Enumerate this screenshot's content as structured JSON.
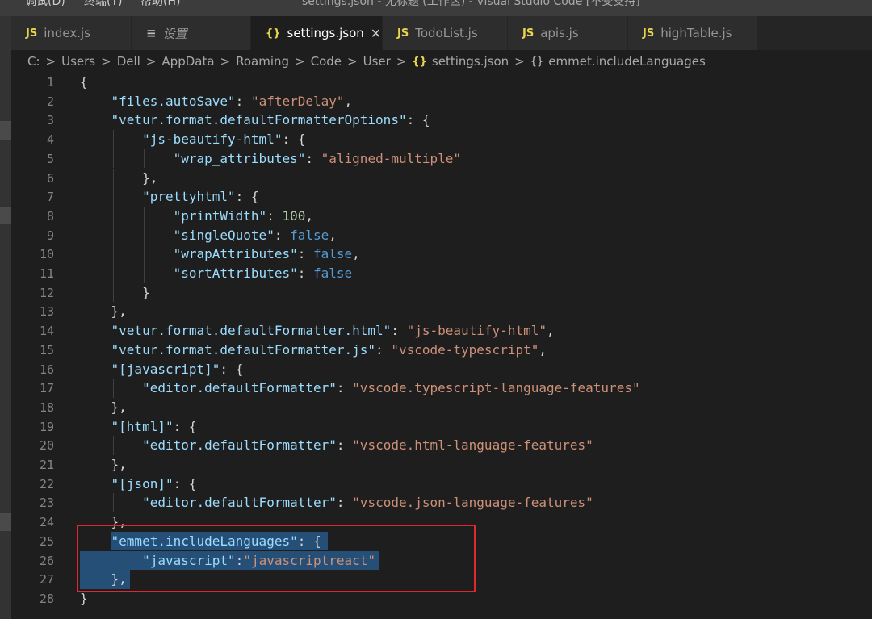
{
  "menubar": {
    "items": [
      "调试(D)",
      "终端(T)",
      "帮助(H)"
    ],
    "window_title": "settings.json - 无标题 (工作区) - Visual Studio Code [不受支持]"
  },
  "tabs": [
    {
      "icon": "JS",
      "label": "index.js",
      "active": false
    },
    {
      "icon": "≡",
      "label": "设置",
      "active": false
    },
    {
      "icon": "{}",
      "label": "settings.json",
      "active": true,
      "close": "✕"
    },
    {
      "icon": "JS",
      "label": "TodoList.js",
      "active": false
    },
    {
      "icon": "JS",
      "label": "apis.js",
      "active": false
    },
    {
      "icon": "JS",
      "label": "highTable.js",
      "active": false
    }
  ],
  "breadcrumb": {
    "segments": [
      "C:",
      "Users",
      "Dell",
      "AppData",
      "Roaming",
      "Code",
      "User"
    ],
    "file": "settings.json",
    "symbol": "emmet.includeLanguages",
    "separator": ">",
    "file_icon": "{}",
    "symbol_icon": "{}"
  },
  "editor": {
    "line_numbers": [
      "1",
      "2",
      "3",
      "4",
      "5",
      "6",
      "7",
      "8",
      "9",
      "10",
      "11",
      "12",
      "13",
      "14",
      "15",
      "16",
      "17",
      "18",
      "19",
      "20",
      "21",
      "22",
      "23",
      "24",
      "25",
      "26",
      "27",
      "28"
    ],
    "lines": [
      "{",
      "    \"files.autoSave\": \"afterDelay\",",
      "    \"vetur.format.defaultFormatterOptions\": {",
      "        \"js-beautify-html\": {",
      "            \"wrap_attributes\": \"aligned-multiple\"",
      "        },",
      "        \"prettyhtml\": {",
      "            \"printWidth\": 100,",
      "            \"singleQuote\": false,",
      "            \"wrapAttributes\": false,",
      "            \"sortAttributes\": false",
      "        }",
      "    },",
      "    \"vetur.format.defaultFormatter.html\": \"js-beautify-html\",",
      "    \"vetur.format.defaultFormatter.js\": \"vscode-typescript\",",
      "    \"[javascript]\": {",
      "        \"editor.defaultFormatter\": \"vscode.typescript-language-features\"",
      "    },",
      "    \"[html]\": {",
      "        \"editor.defaultFormatter\": \"vscode.html-language-features\"",
      "    },",
      "    \"[json]\": {",
      "        \"editor.defaultFormatter\": \"vscode.json-language-features\"",
      "    },",
      "    \"emmet.includeLanguages\": {",
      "        \"javascript\":\"javascriptreact\"",
      "    },",
      "}"
    ],
    "selected_lines": [
      25,
      26,
      27
    ]
  },
  "colors": {
    "key": "#9cdcfe",
    "string": "#ce9178",
    "number": "#b5cea8",
    "boolean": "#569cd6",
    "punctuation": "#d4d4d4",
    "selection": "#264f78",
    "annotation_box": "#e0282e",
    "js_icon": "#e8d44d"
  }
}
